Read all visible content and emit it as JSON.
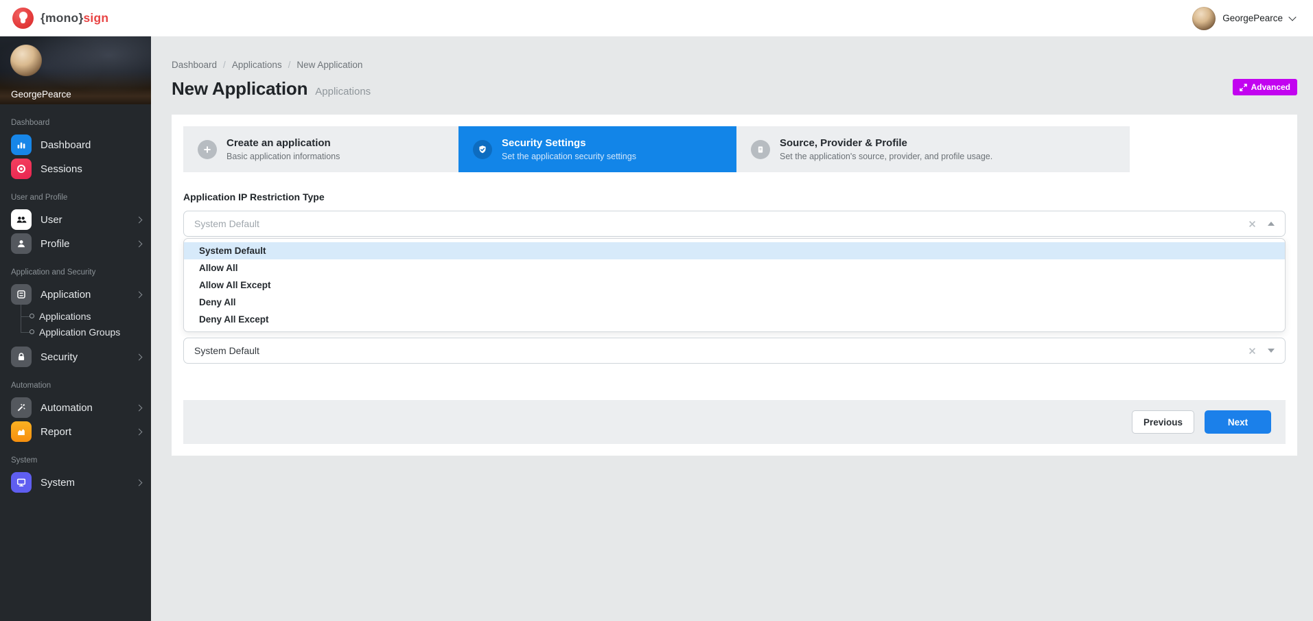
{
  "topbar": {
    "brand_left": "{mono}",
    "brand_right": "sign",
    "user_name": "GeorgePearce"
  },
  "sidebar": {
    "profile_name": "GeorgePearce",
    "sections": [
      {
        "label": "Dashboard",
        "items": [
          {
            "label": "Dashboard",
            "icon": "bar-chart-icon",
            "has_chevron": false
          },
          {
            "label": "Sessions",
            "icon": "record-icon",
            "has_chevron": false
          }
        ]
      },
      {
        "label": "User and Profile",
        "items": [
          {
            "label": "User",
            "icon": "users-icon",
            "has_chevron": true
          },
          {
            "label": "Profile",
            "icon": "person-icon",
            "has_chevron": true
          }
        ]
      },
      {
        "label": "Application and Security",
        "items": [
          {
            "label": "Application",
            "icon": "archive-icon",
            "has_chevron": true,
            "expanded": true,
            "children": [
              {
                "label": "Applications"
              },
              {
                "label": "Application Groups"
              }
            ]
          },
          {
            "label": "Security",
            "icon": "lock-icon",
            "has_chevron": true
          }
        ]
      },
      {
        "label": "Automation",
        "items": [
          {
            "label": "Automation",
            "icon": "wand-icon",
            "has_chevron": true
          },
          {
            "label": "Report",
            "icon": "report-chart-icon",
            "has_chevron": true
          }
        ]
      },
      {
        "label": "System",
        "items": [
          {
            "label": "System",
            "icon": "monitor-icon",
            "has_chevron": true
          }
        ]
      }
    ]
  },
  "page": {
    "breadcrumb": [
      "Dashboard",
      "Applications",
      "New Application"
    ],
    "breadcrumb_separator": "/",
    "title": "New Application",
    "subtitle": "Applications",
    "advanced_label": "Advanced"
  },
  "wizard": {
    "steps": [
      {
        "title": "Create an application",
        "subtitle": "Basic application informations",
        "icon": "plus-icon",
        "state": "inactive"
      },
      {
        "title": "Security Settings",
        "subtitle": "Set the application security settings",
        "icon": "shield-check-icon",
        "state": "active"
      },
      {
        "title": "Source, Provider & Profile",
        "subtitle": "Set the application's source, provider, and profile usage.",
        "icon": "document-icon",
        "state": "inactive"
      }
    ]
  },
  "form": {
    "field_label": "Application IP Restriction Type",
    "open_select": {
      "placeholder": "System Default",
      "clear_icon": "x-icon",
      "caret_icon": "caret-up-icon"
    },
    "dropdown_options": [
      {
        "label": "System Default",
        "highlighted": true
      },
      {
        "label": "Allow All",
        "highlighted": false
      },
      {
        "label": "Allow All Except",
        "highlighted": false
      },
      {
        "label": "Deny All",
        "highlighted": false
      },
      {
        "label": "Deny All Except",
        "highlighted": false
      }
    ],
    "closed_select": {
      "value": "System Default",
      "clear_icon": "x-icon",
      "caret_icon": "caret-down-icon"
    }
  },
  "footer": {
    "previous_label": "Previous",
    "next_label": "Next"
  },
  "colors": {
    "accent_blue": "#1285e8",
    "advanced_magenta": "#c203f0",
    "highlight_option_bg": "#d7eafa",
    "sidebar_bg": "#24282c",
    "logo_red": "#e84545",
    "sessions_red": "#f02e55",
    "dashboard_blue": "#1786e8",
    "report_orange": "#f79d13",
    "system_indigo": "#5f5ef0",
    "step_inactive_bg": "#eceef0",
    "next_button_blue": "#1b80ea"
  }
}
